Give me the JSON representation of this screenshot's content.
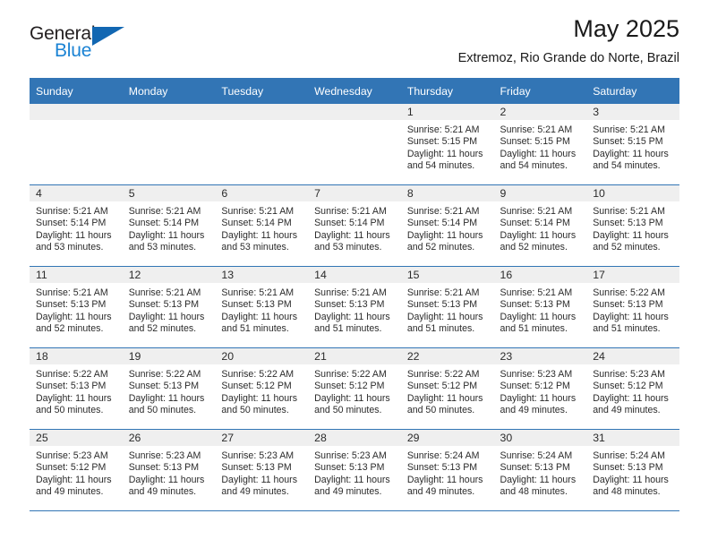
{
  "brand": {
    "word1": "General",
    "word2": "Blue",
    "triangle_icon": "triangle-icon",
    "color_dark": "#231f20",
    "color_blue": "#1b83d4"
  },
  "header": {
    "title": "May 2025",
    "location": "Extremoz, Rio Grande do Norte, Brazil"
  },
  "theme": {
    "header_blue": "#3275b5",
    "daynum_gray": "#efefef",
    "text": "#2b2b2b"
  },
  "weekdays": [
    "Sunday",
    "Monday",
    "Tuesday",
    "Wednesday",
    "Thursday",
    "Friday",
    "Saturday"
  ],
  "weeks": [
    [
      {
        "day": "",
        "empty": true
      },
      {
        "day": "",
        "empty": true
      },
      {
        "day": "",
        "empty": true
      },
      {
        "day": "",
        "empty": true
      },
      {
        "day": "1",
        "sunrise": "Sunrise: 5:21 AM",
        "sunset": "Sunset: 5:15 PM",
        "daylight1": "Daylight: 11 hours",
        "daylight2": "and 54 minutes."
      },
      {
        "day": "2",
        "sunrise": "Sunrise: 5:21 AM",
        "sunset": "Sunset: 5:15 PM",
        "daylight1": "Daylight: 11 hours",
        "daylight2": "and 54 minutes."
      },
      {
        "day": "3",
        "sunrise": "Sunrise: 5:21 AM",
        "sunset": "Sunset: 5:15 PM",
        "daylight1": "Daylight: 11 hours",
        "daylight2": "and 54 minutes."
      }
    ],
    [
      {
        "day": "4",
        "sunrise": "Sunrise: 5:21 AM",
        "sunset": "Sunset: 5:14 PM",
        "daylight1": "Daylight: 11 hours",
        "daylight2": "and 53 minutes."
      },
      {
        "day": "5",
        "sunrise": "Sunrise: 5:21 AM",
        "sunset": "Sunset: 5:14 PM",
        "daylight1": "Daylight: 11 hours",
        "daylight2": "and 53 minutes."
      },
      {
        "day": "6",
        "sunrise": "Sunrise: 5:21 AM",
        "sunset": "Sunset: 5:14 PM",
        "daylight1": "Daylight: 11 hours",
        "daylight2": "and 53 minutes."
      },
      {
        "day": "7",
        "sunrise": "Sunrise: 5:21 AM",
        "sunset": "Sunset: 5:14 PM",
        "daylight1": "Daylight: 11 hours",
        "daylight2": "and 53 minutes."
      },
      {
        "day": "8",
        "sunrise": "Sunrise: 5:21 AM",
        "sunset": "Sunset: 5:14 PM",
        "daylight1": "Daylight: 11 hours",
        "daylight2": "and 52 minutes."
      },
      {
        "day": "9",
        "sunrise": "Sunrise: 5:21 AM",
        "sunset": "Sunset: 5:14 PM",
        "daylight1": "Daylight: 11 hours",
        "daylight2": "and 52 minutes."
      },
      {
        "day": "10",
        "sunrise": "Sunrise: 5:21 AM",
        "sunset": "Sunset: 5:13 PM",
        "daylight1": "Daylight: 11 hours",
        "daylight2": "and 52 minutes."
      }
    ],
    [
      {
        "day": "11",
        "sunrise": "Sunrise: 5:21 AM",
        "sunset": "Sunset: 5:13 PM",
        "daylight1": "Daylight: 11 hours",
        "daylight2": "and 52 minutes."
      },
      {
        "day": "12",
        "sunrise": "Sunrise: 5:21 AM",
        "sunset": "Sunset: 5:13 PM",
        "daylight1": "Daylight: 11 hours",
        "daylight2": "and 52 minutes."
      },
      {
        "day": "13",
        "sunrise": "Sunrise: 5:21 AM",
        "sunset": "Sunset: 5:13 PM",
        "daylight1": "Daylight: 11 hours",
        "daylight2": "and 51 minutes."
      },
      {
        "day": "14",
        "sunrise": "Sunrise: 5:21 AM",
        "sunset": "Sunset: 5:13 PM",
        "daylight1": "Daylight: 11 hours",
        "daylight2": "and 51 minutes."
      },
      {
        "day": "15",
        "sunrise": "Sunrise: 5:21 AM",
        "sunset": "Sunset: 5:13 PM",
        "daylight1": "Daylight: 11 hours",
        "daylight2": "and 51 minutes."
      },
      {
        "day": "16",
        "sunrise": "Sunrise: 5:21 AM",
        "sunset": "Sunset: 5:13 PM",
        "daylight1": "Daylight: 11 hours",
        "daylight2": "and 51 minutes."
      },
      {
        "day": "17",
        "sunrise": "Sunrise: 5:22 AM",
        "sunset": "Sunset: 5:13 PM",
        "daylight1": "Daylight: 11 hours",
        "daylight2": "and 51 minutes."
      }
    ],
    [
      {
        "day": "18",
        "sunrise": "Sunrise: 5:22 AM",
        "sunset": "Sunset: 5:13 PM",
        "daylight1": "Daylight: 11 hours",
        "daylight2": "and 50 minutes."
      },
      {
        "day": "19",
        "sunrise": "Sunrise: 5:22 AM",
        "sunset": "Sunset: 5:13 PM",
        "daylight1": "Daylight: 11 hours",
        "daylight2": "and 50 minutes."
      },
      {
        "day": "20",
        "sunrise": "Sunrise: 5:22 AM",
        "sunset": "Sunset: 5:12 PM",
        "daylight1": "Daylight: 11 hours",
        "daylight2": "and 50 minutes."
      },
      {
        "day": "21",
        "sunrise": "Sunrise: 5:22 AM",
        "sunset": "Sunset: 5:12 PM",
        "daylight1": "Daylight: 11 hours",
        "daylight2": "and 50 minutes."
      },
      {
        "day": "22",
        "sunrise": "Sunrise: 5:22 AM",
        "sunset": "Sunset: 5:12 PM",
        "daylight1": "Daylight: 11 hours",
        "daylight2": "and 50 minutes."
      },
      {
        "day": "23",
        "sunrise": "Sunrise: 5:23 AM",
        "sunset": "Sunset: 5:12 PM",
        "daylight1": "Daylight: 11 hours",
        "daylight2": "and 49 minutes."
      },
      {
        "day": "24",
        "sunrise": "Sunrise: 5:23 AM",
        "sunset": "Sunset: 5:12 PM",
        "daylight1": "Daylight: 11 hours",
        "daylight2": "and 49 minutes."
      }
    ],
    [
      {
        "day": "25",
        "sunrise": "Sunrise: 5:23 AM",
        "sunset": "Sunset: 5:12 PM",
        "daylight1": "Daylight: 11 hours",
        "daylight2": "and 49 minutes."
      },
      {
        "day": "26",
        "sunrise": "Sunrise: 5:23 AM",
        "sunset": "Sunset: 5:13 PM",
        "daylight1": "Daylight: 11 hours",
        "daylight2": "and 49 minutes."
      },
      {
        "day": "27",
        "sunrise": "Sunrise: 5:23 AM",
        "sunset": "Sunset: 5:13 PM",
        "daylight1": "Daylight: 11 hours",
        "daylight2": "and 49 minutes."
      },
      {
        "day": "28",
        "sunrise": "Sunrise: 5:23 AM",
        "sunset": "Sunset: 5:13 PM",
        "daylight1": "Daylight: 11 hours",
        "daylight2": "and 49 minutes."
      },
      {
        "day": "29",
        "sunrise": "Sunrise: 5:24 AM",
        "sunset": "Sunset: 5:13 PM",
        "daylight1": "Daylight: 11 hours",
        "daylight2": "and 49 minutes."
      },
      {
        "day": "30",
        "sunrise": "Sunrise: 5:24 AM",
        "sunset": "Sunset: 5:13 PM",
        "daylight1": "Daylight: 11 hours",
        "daylight2": "and 48 minutes."
      },
      {
        "day": "31",
        "sunrise": "Sunrise: 5:24 AM",
        "sunset": "Sunset: 5:13 PM",
        "daylight1": "Daylight: 11 hours",
        "daylight2": "and 48 minutes."
      }
    ]
  ]
}
